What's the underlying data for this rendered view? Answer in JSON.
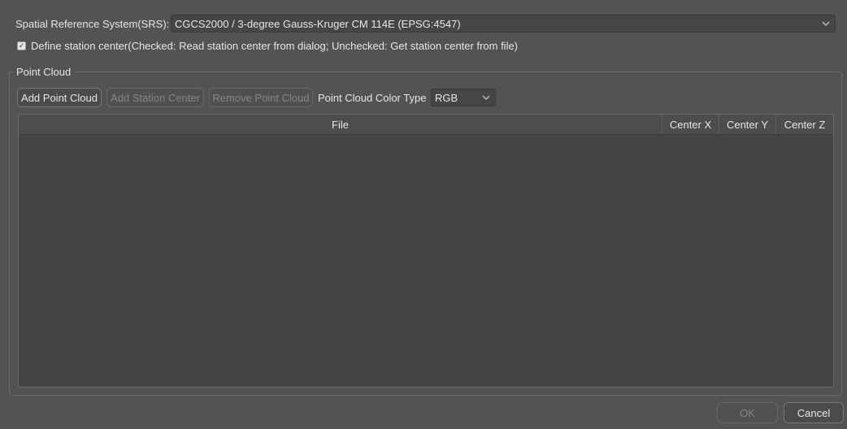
{
  "srs": {
    "label": "Spatial Reference System(SRS):",
    "value": "CGCS2000 / 3-degree Gauss-Kruger CM 114E (EPSG:4547)"
  },
  "station_center": {
    "checked": true,
    "label": "Define station center(Checked: Read station center from dialog; Unchecked: Get station center from file)"
  },
  "point_cloud": {
    "group_title": "Point Cloud",
    "add_label": "Add Point Cloud",
    "add_station_label": "Add Station Center",
    "remove_label": "Remove Point Cloud",
    "color_type_label": "Point Cloud Color Type",
    "color_type_value": "RGB",
    "columns": [
      "File",
      "Center X",
      "Center Y",
      "Center Z"
    ],
    "rows": []
  },
  "footer": {
    "ok_label": "OK",
    "cancel_label": "Cancel"
  },
  "icons": {
    "dropdown": "chevron-down-icon",
    "checkbox": "checkmark-icon"
  }
}
